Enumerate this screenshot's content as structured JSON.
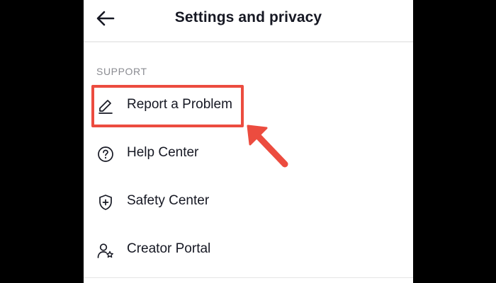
{
  "header": {
    "title": "Settings and privacy",
    "back_icon": "arrow-left-icon"
  },
  "section": {
    "label": "SUPPORT"
  },
  "items": [
    {
      "label": "Report a Problem",
      "icon": "pencil-icon"
    },
    {
      "label": "Help Center",
      "icon": "question-circle-icon"
    },
    {
      "label": "Safety Center",
      "icon": "shield-plus-icon"
    },
    {
      "label": "Creator Portal",
      "icon": "person-star-icon"
    }
  ],
  "annotation": {
    "highlight_color": "#ec4c3f",
    "highlighted_item": "Report a Problem"
  },
  "colors": {
    "text": "#161823",
    "section_label": "#8a8b91",
    "background": "#ffffff",
    "frame": "#000000"
  }
}
